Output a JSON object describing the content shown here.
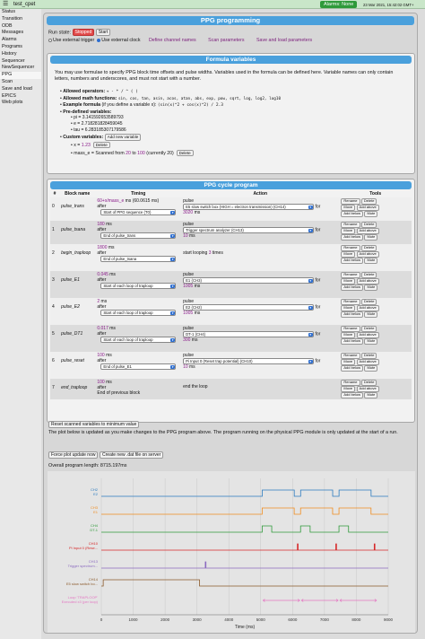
{
  "header": {
    "menu_icon": "hamburger-icon",
    "experiment": "test_cpet",
    "alarm": "Alarms: None",
    "date": "23 Mar 2021, 15:42:02 GMT+"
  },
  "sidebar": {
    "items": [
      "Status",
      "Transition",
      "ODB",
      "Messages",
      "Alarms",
      "Programs",
      "History",
      "Sequencer",
      "NewSequencer",
      "PPG",
      "Scan",
      "Save and load",
      "EPICS",
      "Web plots"
    ]
  },
  "page": {
    "title": "PPG programming",
    "run_state_label": "Run state:",
    "run_state": "Stopped",
    "start_button": "Start",
    "external_trigger": "Use external trigger",
    "external_clock": "Use external clock",
    "link_channels": "Define channel names",
    "link_scan": "Scan parameters",
    "link_save": "Save and load parameters"
  },
  "formula": {
    "title": "Formula variables",
    "intro": "You may use formulae to specify PPG block time offsets and pulse widths. Variables used in the formula can be defined here. Variable names can only contain letters, numbers and underscores, and must not start with a number.",
    "ops_label": "Allowed operators:",
    "ops": "+ - * / ^ ( )",
    "funcs_label": "Allowed math functions:",
    "funcs": "sin, cos, tan, asin, acos, atan, abs, exp, pow, sqrt, log, log2, log10",
    "example_label": "Example formula",
    "example_mid": "(if you define a variable x):",
    "example": "(sin(x)^2 + cos(x)^2) / 2.3",
    "pre_label": "Pre-defined variables:",
    "pi": "pi = 3.141592653589793",
    "e": "e = 2.718281828459045",
    "tau": "tau = 6.283185307179586",
    "custom_label": "Custom variables:",
    "add_var": "Add new variable",
    "x_label": "x =",
    "x_val": "1.23",
    "delete": "Delete",
    "mass_pre": "mass_e = Scanned from",
    "mass_from": "20",
    "mass_to_word": "to",
    "mass_to": "100",
    "mass_post": "(currently 20)"
  },
  "cycle": {
    "title": "PPG cycle program",
    "headers": [
      "#",
      "Block name",
      "Timing",
      "Action",
      "Tools"
    ],
    "blocks": [
      {
        "num": "0",
        "name": "pulse_trans",
        "t1": "60+x/mass_e",
        "t1u": "ms (60.0615 ms)",
        "after": "after",
        "ref": "Start of PPG sequence (T0)",
        "action": "pulse",
        "chan": "E5 slow switch box (HIGH = electron transmission) (CH14)",
        "for": "for",
        "dur": "3020",
        "unit": "ms"
      },
      {
        "num": "1",
        "name": "pulse_tsana",
        "t1": "180",
        "t1u": "ms",
        "after": "after",
        "ref": "End of pulse_trans",
        "action": "pulse",
        "chan": "Trigger spectrum analyzer (CH13)",
        "for": "for",
        "dur": "10",
        "unit": "ms"
      },
      {
        "num": "2",
        "name": "begin_traploop",
        "t1": "1800",
        "t1u": "ms",
        "after": "after",
        "ref": "End of pulse_tsana",
        "action": "start looping",
        "count": "3",
        "unit": "times"
      },
      {
        "num": "3",
        "name": "pulse_E1",
        "t1": "0.045",
        "t1u": "ms",
        "after": "after",
        "ref": "Start of each loop of traploop",
        "action": "pulse",
        "chan": "E1 (CH3)",
        "for": "for",
        "dur": "1005",
        "unit": "ms"
      },
      {
        "num": "4",
        "name": "pulse_E2",
        "t1": "2",
        "t1u": "ms",
        "after": "after",
        "ref": "Start of each loop of traploop",
        "action": "pulse",
        "chan": "E2 (CH2)",
        "for": "for",
        "dur": "1005",
        "unit": "ms"
      },
      {
        "num": "5",
        "name": "pulse_DT1",
        "t1": "0.017",
        "t1u": "ms",
        "after": "after",
        "ref": "Start of each loop of traploop",
        "action": "pulse",
        "chan": "DT-1 (CH4)",
        "for": "for",
        "dur": "300",
        "unit": "ms"
      },
      {
        "num": "6",
        "name": "pulse_reset",
        "t1": "100",
        "t1u": "ms",
        "after": "after",
        "ref": "End of pulse_E1",
        "action": "pulse",
        "chan": "Pi Input 0 (Reset trap potential) (CH10)",
        "for": "for",
        "dur": "10",
        "unit": "ms"
      },
      {
        "num": "7",
        "name": "end_traploop",
        "t1": "100",
        "t1u": "ms",
        "after": "after",
        "ref": "End of previous block",
        "action": "end the loop"
      }
    ],
    "tools": {
      "rename": "Rename",
      "delete": "Delete",
      "move": "Move",
      "add_above": "Add above",
      "add_below": "Add below",
      "mute": "Mute"
    }
  },
  "bottom": {
    "reset_scanned": "Reset scanned variables to minimum value",
    "note": "The plot below is updated as you make changes to the PPG program above. The program running on the physical PPG module is only updated at the start of a run.",
    "force_update": "Force plot update now",
    "create_dat": "Create new .dat file on server",
    "length_label": "Overall program length:",
    "length": "8715.197ms"
  },
  "chart_data": {
    "type": "line",
    "xlabel": "Time (ms)",
    "xlim": [
      0,
      9000
    ],
    "ticks": [
      "0",
      "1000",
      "2000",
      "3000",
      "4000",
      "5000",
      "6000",
      "7000",
      "8000",
      "9000"
    ],
    "channels": [
      {
        "name": "CH2",
        "sub": "E2",
        "color": "#2b7bbf",
        "high": [
          [
            5047,
            6052
          ],
          [
            6252,
            7257
          ],
          [
            7457,
            8462
          ]
        ]
      },
      {
        "name": "CH3",
        "sub": "E1",
        "color": "#f08c1e",
        "high": [
          [
            5045,
            6050
          ],
          [
            6250,
            7255
          ],
          [
            7455,
            8460
          ]
        ]
      },
      {
        "name": "CH4",
        "sub": "DT-1",
        "color": "#2e9a3a",
        "high": [
          [
            5045,
            5345
          ],
          [
            6250,
            6550
          ],
          [
            7455,
            7755
          ]
        ]
      },
      {
        "name": "CH10",
        "sub": "Pi Input 0 (Rese...",
        "color": "#d62728",
        "high": [
          [
            6150,
            6160
          ],
          [
            7355,
            7365
          ],
          [
            8560,
            8570
          ]
        ]
      },
      {
        "name": "CH13",
        "sub": "Trigger spectrum...",
        "color": "#8c6bc0",
        "high": [
          [
            3260,
            3270
          ]
        ]
      },
      {
        "name": "CH14",
        "sub": "E5 slow switch bo...",
        "color": "#8b5a2b",
        "high": [
          [
            60,
            3080
          ]
        ]
      },
      {
        "name": "Loop 'TRAPLOOP'",
        "sub": "Executed x3 (per loop)",
        "color": "#e377c2",
        "loop": [
          [
            5045,
            6250
          ],
          [
            6250,
            7455
          ],
          [
            7455,
            8660
          ]
        ]
      }
    ]
  }
}
